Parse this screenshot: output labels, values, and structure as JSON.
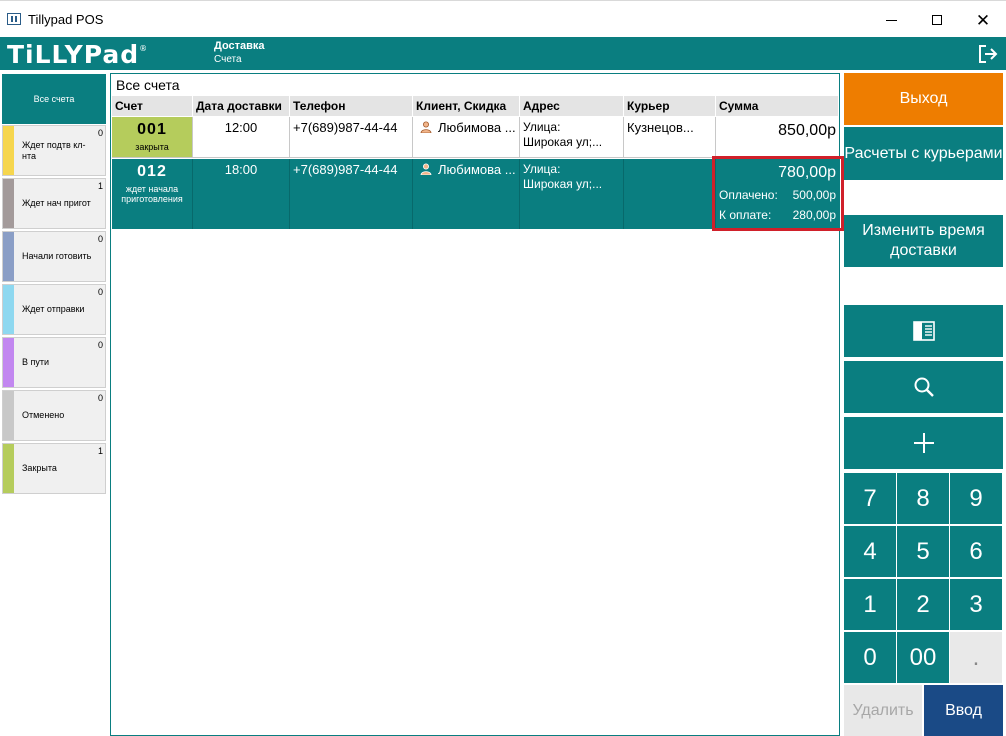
{
  "window": {
    "title": "Tillypad POS"
  },
  "header": {
    "logo": "TiLLYPad",
    "breadcrumb_top": "Доставка",
    "breadcrumb_bottom": "Счета"
  },
  "sidebar": {
    "all_label": "Все счета",
    "items": [
      {
        "label": "Ждет подтв кл-нта",
        "count": "0",
        "color": "#f6d64e"
      },
      {
        "label": "Ждет нач пригот",
        "count": "1",
        "color": "#a39a9a"
      },
      {
        "label": "Начали готовить",
        "count": "0",
        "color": "#8a9ec6"
      },
      {
        "label": "Ждет отправки",
        "count": "0",
        "color": "#8ed8f0"
      },
      {
        "label": "В пути",
        "count": "0",
        "color": "#c287f0"
      },
      {
        "label": "Отменено",
        "count": "0",
        "color": "#c8c8c8"
      },
      {
        "label": "Закрыта",
        "count": "1",
        "color": "#b5cc5c"
      }
    ]
  },
  "list": {
    "title": "Все счета",
    "columns": [
      "Счет",
      "Дата доставки",
      "Телефон",
      "Клиент, Скидка",
      "Адрес",
      "Курьер",
      "Сумма"
    ],
    "rows": [
      {
        "number": "001",
        "status": "закрыта",
        "time": "12:00",
        "phone": "+7(689)987-44-44",
        "client": "Любимова ...",
        "address_1": "Улица:",
        "address_2": "Широкая ул;...",
        "courier": "Кузнецов...",
        "sum": "850,00р"
      },
      {
        "number": "012",
        "status": "ждет начала приготовления",
        "time": "18:00",
        "phone": "+7(689)987-44-44",
        "client": "Любимова ...",
        "address_1": "Улица:",
        "address_2": "Широкая ул;...",
        "courier": "",
        "sum": "780,00р",
        "paid_label": "Оплачено:",
        "paid_value": "500,00р",
        "due_label": "К оплате:",
        "due_value": "280,00р"
      }
    ]
  },
  "actions": {
    "exit": "Выход",
    "couriers": "Расчеты с курьерами",
    "change_time": "Изменить время доставки"
  },
  "numpad": {
    "keys": [
      "7",
      "8",
      "9",
      "4",
      "5",
      "6",
      "1",
      "2",
      "3",
      "0",
      "00",
      "."
    ],
    "delete": "Удалить",
    "enter": "Ввод"
  },
  "colors": {
    "teal": "#0a7e80",
    "orange": "#ee7d00",
    "enter_blue": "#1a4a86",
    "highlight": "#d0202a"
  }
}
